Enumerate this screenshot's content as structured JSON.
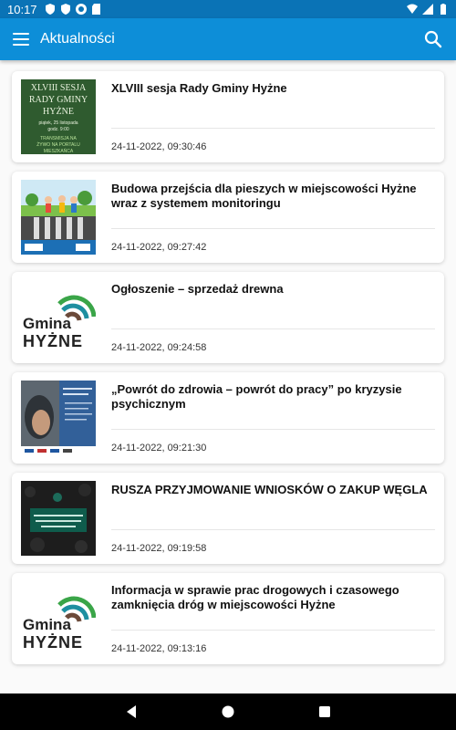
{
  "status_bar": {
    "time": "10:17"
  },
  "app_bar": {
    "title": "Aktualności",
    "menu_icon": "menu-icon",
    "search_icon": "search-icon"
  },
  "posts": [
    {
      "title": "XLVIII sesja Rady Gminy Hyżne",
      "date": "24-11-2022, 09:30:46",
      "thumb": {
        "line1": "XLVIII SESJA",
        "line2": "RADY GMINY",
        "line3": "HYŻNE",
        "line4": "piątek, 25 listopada",
        "line5": "godz. 9:00",
        "line6": "TRANSMISJA NA",
        "line7": "ŻYWO NA PORTALU",
        "line8": "MIESZKAŃCA"
      }
    },
    {
      "title": "Budowa przejścia dla pieszych w miejscowości Hyżne wraz z systemem monitoringu",
      "date": "24-11-2022, 09:27:42"
    },
    {
      "title": "Ogłoszenie – sprzedaż drewna",
      "date": "24-11-2022, 09:24:58",
      "logo": {
        "word1": "Gmina",
        "word2": "HYŻNE"
      }
    },
    {
      "title": "„Powrót do zdrowia – powrót do pracy” po kryzysie psychicznym",
      "date": "24-11-2022, 09:21:30"
    },
    {
      "title": "RUSZA PRZYJMOWANIE WNIOSKÓW O ZAKUP WĘGLA",
      "date": "24-11-2022, 09:19:58"
    },
    {
      "title": "Informacja w sprawie prac drogowych i czasowego zamknięcia dróg w miejscowości Hyżne",
      "date": "24-11-2022, 09:13:16",
      "logo": {
        "word1": "Gmina",
        "word2": "HYŻNE"
      }
    }
  ],
  "colors": {
    "status_bar": "#0a73b6",
    "app_bar": "#0d8ed8",
    "logo_green": "#3aa548",
    "logo_teal": "#1e8fa0",
    "logo_brown": "#6b4a3a"
  }
}
